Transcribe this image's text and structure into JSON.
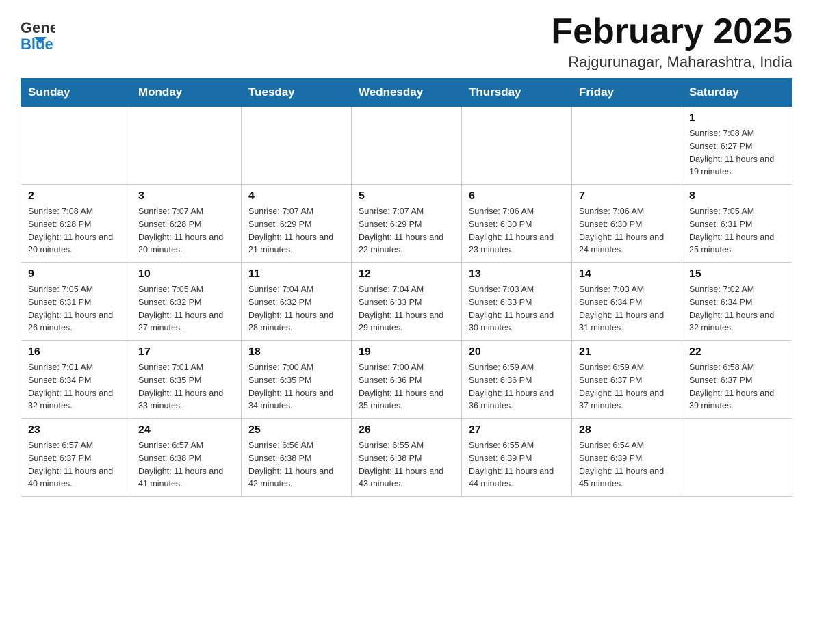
{
  "header": {
    "logo_general": "General",
    "logo_blue": "Blue",
    "month_title": "February 2025",
    "location": "Rajgurunagar, Maharashtra, India"
  },
  "weekdays": [
    "Sunday",
    "Monday",
    "Tuesday",
    "Wednesday",
    "Thursday",
    "Friday",
    "Saturday"
  ],
  "weeks": [
    [
      {
        "day": "",
        "info": ""
      },
      {
        "day": "",
        "info": ""
      },
      {
        "day": "",
        "info": ""
      },
      {
        "day": "",
        "info": ""
      },
      {
        "day": "",
        "info": ""
      },
      {
        "day": "",
        "info": ""
      },
      {
        "day": "1",
        "info": "Sunrise: 7:08 AM\nSunset: 6:27 PM\nDaylight: 11 hours and 19 minutes."
      }
    ],
    [
      {
        "day": "2",
        "info": "Sunrise: 7:08 AM\nSunset: 6:28 PM\nDaylight: 11 hours and 20 minutes."
      },
      {
        "day": "3",
        "info": "Sunrise: 7:07 AM\nSunset: 6:28 PM\nDaylight: 11 hours and 20 minutes."
      },
      {
        "day": "4",
        "info": "Sunrise: 7:07 AM\nSunset: 6:29 PM\nDaylight: 11 hours and 21 minutes."
      },
      {
        "day": "5",
        "info": "Sunrise: 7:07 AM\nSunset: 6:29 PM\nDaylight: 11 hours and 22 minutes."
      },
      {
        "day": "6",
        "info": "Sunrise: 7:06 AM\nSunset: 6:30 PM\nDaylight: 11 hours and 23 minutes."
      },
      {
        "day": "7",
        "info": "Sunrise: 7:06 AM\nSunset: 6:30 PM\nDaylight: 11 hours and 24 minutes."
      },
      {
        "day": "8",
        "info": "Sunrise: 7:05 AM\nSunset: 6:31 PM\nDaylight: 11 hours and 25 minutes."
      }
    ],
    [
      {
        "day": "9",
        "info": "Sunrise: 7:05 AM\nSunset: 6:31 PM\nDaylight: 11 hours and 26 minutes."
      },
      {
        "day": "10",
        "info": "Sunrise: 7:05 AM\nSunset: 6:32 PM\nDaylight: 11 hours and 27 minutes."
      },
      {
        "day": "11",
        "info": "Sunrise: 7:04 AM\nSunset: 6:32 PM\nDaylight: 11 hours and 28 minutes."
      },
      {
        "day": "12",
        "info": "Sunrise: 7:04 AM\nSunset: 6:33 PM\nDaylight: 11 hours and 29 minutes."
      },
      {
        "day": "13",
        "info": "Sunrise: 7:03 AM\nSunset: 6:33 PM\nDaylight: 11 hours and 30 minutes."
      },
      {
        "day": "14",
        "info": "Sunrise: 7:03 AM\nSunset: 6:34 PM\nDaylight: 11 hours and 31 minutes."
      },
      {
        "day": "15",
        "info": "Sunrise: 7:02 AM\nSunset: 6:34 PM\nDaylight: 11 hours and 32 minutes."
      }
    ],
    [
      {
        "day": "16",
        "info": "Sunrise: 7:01 AM\nSunset: 6:34 PM\nDaylight: 11 hours and 32 minutes."
      },
      {
        "day": "17",
        "info": "Sunrise: 7:01 AM\nSunset: 6:35 PM\nDaylight: 11 hours and 33 minutes."
      },
      {
        "day": "18",
        "info": "Sunrise: 7:00 AM\nSunset: 6:35 PM\nDaylight: 11 hours and 34 minutes."
      },
      {
        "day": "19",
        "info": "Sunrise: 7:00 AM\nSunset: 6:36 PM\nDaylight: 11 hours and 35 minutes."
      },
      {
        "day": "20",
        "info": "Sunrise: 6:59 AM\nSunset: 6:36 PM\nDaylight: 11 hours and 36 minutes."
      },
      {
        "day": "21",
        "info": "Sunrise: 6:59 AM\nSunset: 6:37 PM\nDaylight: 11 hours and 37 minutes."
      },
      {
        "day": "22",
        "info": "Sunrise: 6:58 AM\nSunset: 6:37 PM\nDaylight: 11 hours and 39 minutes."
      }
    ],
    [
      {
        "day": "23",
        "info": "Sunrise: 6:57 AM\nSunset: 6:37 PM\nDaylight: 11 hours and 40 minutes."
      },
      {
        "day": "24",
        "info": "Sunrise: 6:57 AM\nSunset: 6:38 PM\nDaylight: 11 hours and 41 minutes."
      },
      {
        "day": "25",
        "info": "Sunrise: 6:56 AM\nSunset: 6:38 PM\nDaylight: 11 hours and 42 minutes."
      },
      {
        "day": "26",
        "info": "Sunrise: 6:55 AM\nSunset: 6:38 PM\nDaylight: 11 hours and 43 minutes."
      },
      {
        "day": "27",
        "info": "Sunrise: 6:55 AM\nSunset: 6:39 PM\nDaylight: 11 hours and 44 minutes."
      },
      {
        "day": "28",
        "info": "Sunrise: 6:54 AM\nSunset: 6:39 PM\nDaylight: 11 hours and 45 minutes."
      },
      {
        "day": "",
        "info": ""
      }
    ]
  ]
}
